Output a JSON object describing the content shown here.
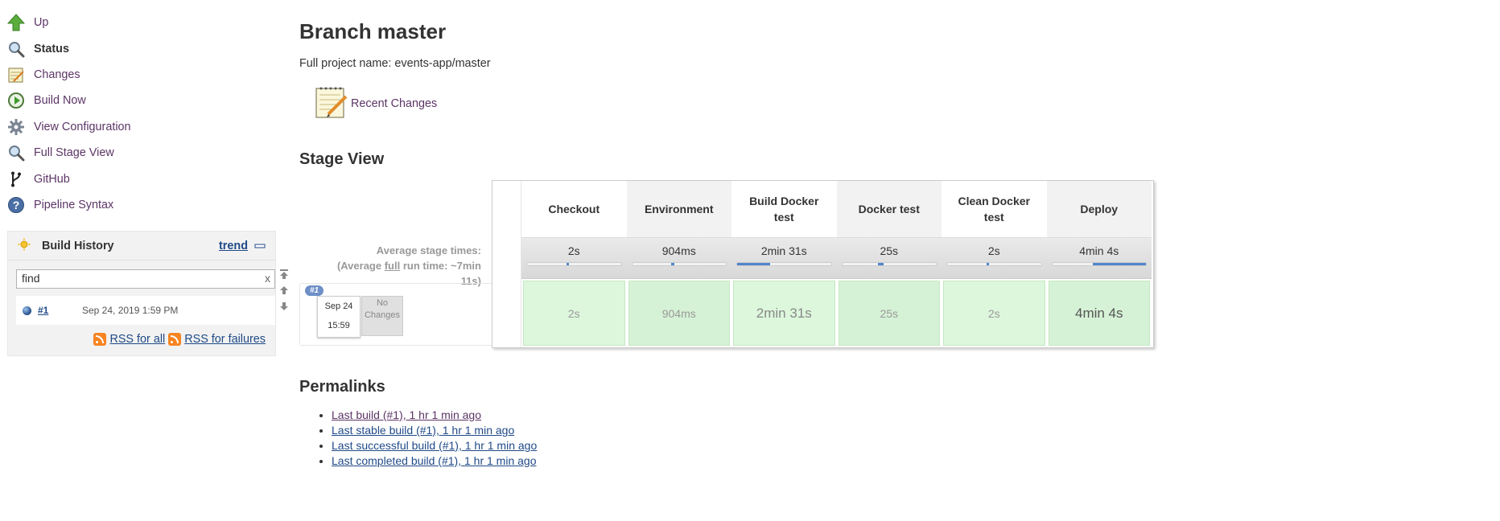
{
  "sidebar": {
    "items": [
      {
        "label": "Up",
        "icon": "up-arrow-icon"
      },
      {
        "label": "Status",
        "icon": "magnifier-icon"
      },
      {
        "label": "Changes",
        "icon": "notepad-icon"
      },
      {
        "label": "Build Now",
        "icon": "clock-play-icon"
      },
      {
        "label": "View Configuration",
        "icon": "gear-icon"
      },
      {
        "label": "Full Stage View",
        "icon": "magnifier-icon"
      },
      {
        "label": "GitHub",
        "icon": "git-branch-icon"
      },
      {
        "label": "Pipeline Syntax",
        "icon": "help-icon"
      }
    ]
  },
  "build_history": {
    "title": "Build History",
    "trend_label": "trend",
    "search_value": "find",
    "clear_label": "x",
    "builds": [
      {
        "number": "#1",
        "date": "Sep 24, 2019 1:59 PM"
      }
    ],
    "rss_all": "RSS for all",
    "rss_failures": "RSS for failures"
  },
  "page": {
    "title": "Branch master",
    "full_name": "Full project name: events-app/master",
    "recent_changes": "Recent Changes"
  },
  "stage_view": {
    "heading": "Stage View",
    "avg_line1": "Average stage times:",
    "avg_line2_pre": "(Average ",
    "avg_line2_full": "full",
    "avg_line2_post": " run time: ~7min",
    "avg_line3": "11s)",
    "run": {
      "badge": "#1",
      "date": "Sep 24",
      "time": "15:59",
      "no_changes_1": "No",
      "no_changes_2": "Changes"
    },
    "stages": [
      {
        "name": "Checkout",
        "avg": "2s",
        "bar_fill": 0.02,
        "cell": "2s"
      },
      {
        "name": "Environment",
        "avg": "904ms",
        "bar_fill": 0.01,
        "cell": "904ms"
      },
      {
        "name": "Build Docker test",
        "avg": "2min 31s",
        "bar_fill": 0.35,
        "cell": "2min 31s"
      },
      {
        "name": "Docker test",
        "avg": "25s",
        "bar_fill": 0.06,
        "cell": "25s"
      },
      {
        "name": "Clean Docker test",
        "avg": "2s",
        "bar_fill": 0.01,
        "cell": "2s"
      },
      {
        "name": "Deploy",
        "avg": "4min 4s",
        "bar_fill": 0.57,
        "cell": "4min 4s"
      }
    ]
  },
  "permalinks": {
    "heading": "Permalinks",
    "items": [
      "Last build (#1), 1 hr 1 min ago",
      "Last stable build (#1), 1 hr 1 min ago",
      "Last successful build (#1), 1 hr 1 min ago",
      "Last completed build (#1), 1 hr 1 min ago"
    ]
  },
  "colors": {
    "link": "#204a87",
    "visited_link": "#5c3566",
    "stage_success": "#ddf7dd",
    "progress_fill": "#4f86cc",
    "rss": "#f78422"
  }
}
